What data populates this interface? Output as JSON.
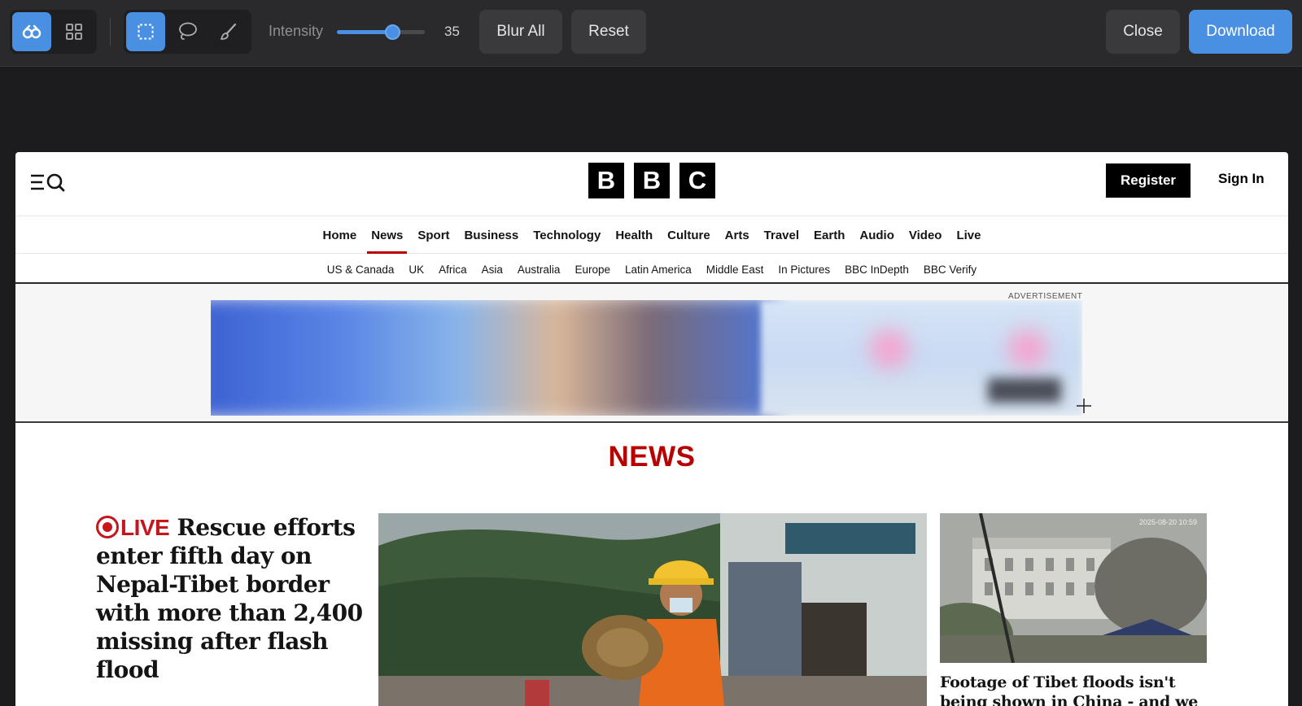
{
  "toolbar": {
    "intensity_label": "Intensity",
    "intensity_value": "35",
    "intensity_fraction": 0.64,
    "blur_all_label": "Blur All",
    "reset_label": "Reset",
    "close_label": "Close",
    "download_label": "Download",
    "accent_color": "#4a90e2",
    "mode_icons": [
      "blur-icon",
      "grid-icon"
    ],
    "tool_icons": [
      "rectangle-select-icon",
      "lasso-icon",
      "brush-icon"
    ]
  },
  "bbc": {
    "logo_letters": [
      "B",
      "B",
      "C"
    ],
    "register_label": "Register",
    "signin_label": "Sign In",
    "nav_primary": [
      "Home",
      "News",
      "Sport",
      "Business",
      "Technology",
      "Health",
      "Culture",
      "Arts",
      "Travel",
      "Earth",
      "Audio",
      "Video",
      "Live"
    ],
    "nav_primary_active": "News",
    "nav_secondary": [
      "US & Canada",
      "UK",
      "Africa",
      "Asia",
      "Australia",
      "Europe",
      "Latin America",
      "Middle East",
      "In Pictures",
      "BBC InDepth",
      "BBC Verify"
    ],
    "ad_label": "ADVERTISEMENT",
    "section_title": "NEWS",
    "lead_live": "LIVE",
    "lead_headline": "Rescue efforts enter fifth day on Nepal-Tibet border with more than 2,400 missing after flash flood",
    "side_caption": "Footage of Tibet floods isn't being shown in China - and we know",
    "side_img_stamp": "2025-08-20 10:59",
    "brand_red": "#b80000"
  }
}
